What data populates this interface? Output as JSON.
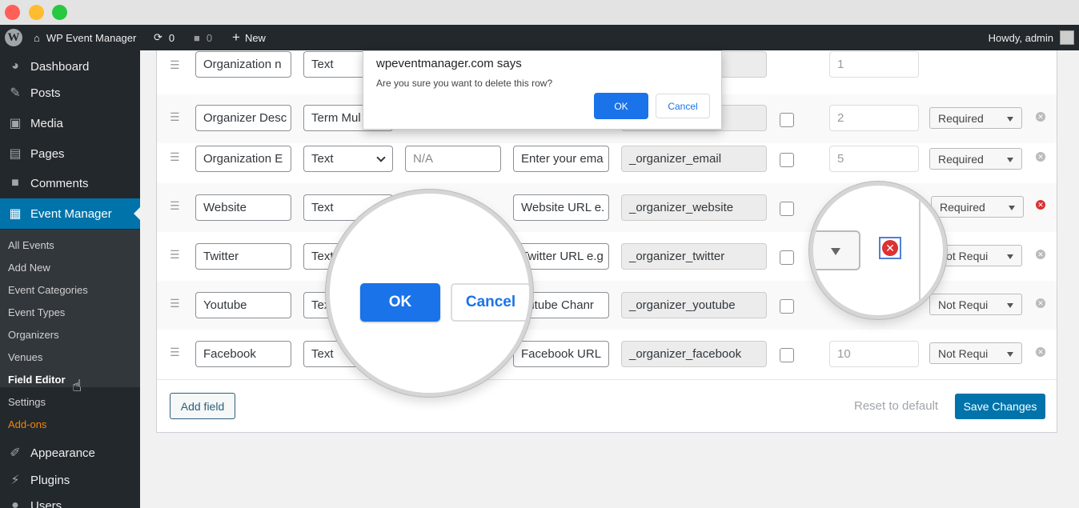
{
  "admin_bar": {
    "site_name": "WP Event Manager",
    "updates_count": "0",
    "comments_count": "0",
    "new_label": "New",
    "howdy": "Howdy, admin"
  },
  "sidebar": {
    "menu": [
      {
        "label": "Dashboard",
        "icon": "dashboard-icon"
      },
      {
        "label": "Posts",
        "icon": "pin-icon"
      },
      {
        "label": "Media",
        "icon": "media-icon"
      },
      {
        "label": "Pages",
        "icon": "pages-icon"
      },
      {
        "label": "Comments",
        "icon": "comment-icon"
      },
      {
        "label": "Event Manager",
        "icon": "calendar-icon"
      }
    ],
    "submenu": [
      "All Events",
      "Add New",
      "Event Categories",
      "Event Types",
      "Organizers",
      "Venues",
      "Field Editor",
      "Settings",
      "Add-ons"
    ],
    "bottom_menu": [
      {
        "label": "Appearance",
        "icon": "brush-icon"
      },
      {
        "label": "Plugins",
        "icon": "plugin-icon"
      },
      {
        "label": "Users",
        "icon": "user-icon"
      }
    ]
  },
  "fields": [
    {
      "label": "Organization n",
      "type": "Text",
      "placeholder": "",
      "description": "",
      "meta_key": "",
      "priority": "1",
      "required": ""
    },
    {
      "label": "Organizer Desc",
      "type": "Term Mul",
      "placeholder": "",
      "description": "",
      "meta_key": "",
      "priority": "2",
      "required": "Required"
    },
    {
      "label": "Organization E",
      "type": "Text",
      "placeholder": "N/A",
      "description": "Enter your ema",
      "meta_key": "_organizer_email",
      "priority": "5",
      "required": "Required"
    },
    {
      "label": "Website",
      "type": "Text",
      "placeholder": "",
      "description": "Website URL e.",
      "meta_key": "_organizer_website",
      "priority": "",
      "required": "Required"
    },
    {
      "label": "Twitter",
      "type": "Text",
      "placeholder": "",
      "description": "Twitter URL e.g",
      "meta_key": "_organizer_twitter",
      "priority": "",
      "required": "Not Requi"
    },
    {
      "label": "Youtube",
      "type": "Tex",
      "placeholder": "",
      "description": "outube Chanr",
      "meta_key": "_organizer_youtube",
      "priority": "",
      "required": "Not Requi"
    },
    {
      "label": "Facebook",
      "type": "Text",
      "placeholder": "",
      "description": "Facebook URL",
      "meta_key": "_organizer_facebook",
      "priority": "10",
      "required": "Not Requi"
    }
  ],
  "actions": {
    "add_field": "Add field",
    "reset": "Reset to default",
    "save": "Save Changes"
  },
  "dialog": {
    "title": "wpeventmanager.com says",
    "message": "Are you sure you want to delete this row?",
    "ok": "OK",
    "cancel": "Cancel"
  },
  "colors": {
    "admin_bar": "#23282d",
    "accent": "#0073aa",
    "dialog_button": "#1a73e8",
    "remove_active": "#dc3232"
  }
}
